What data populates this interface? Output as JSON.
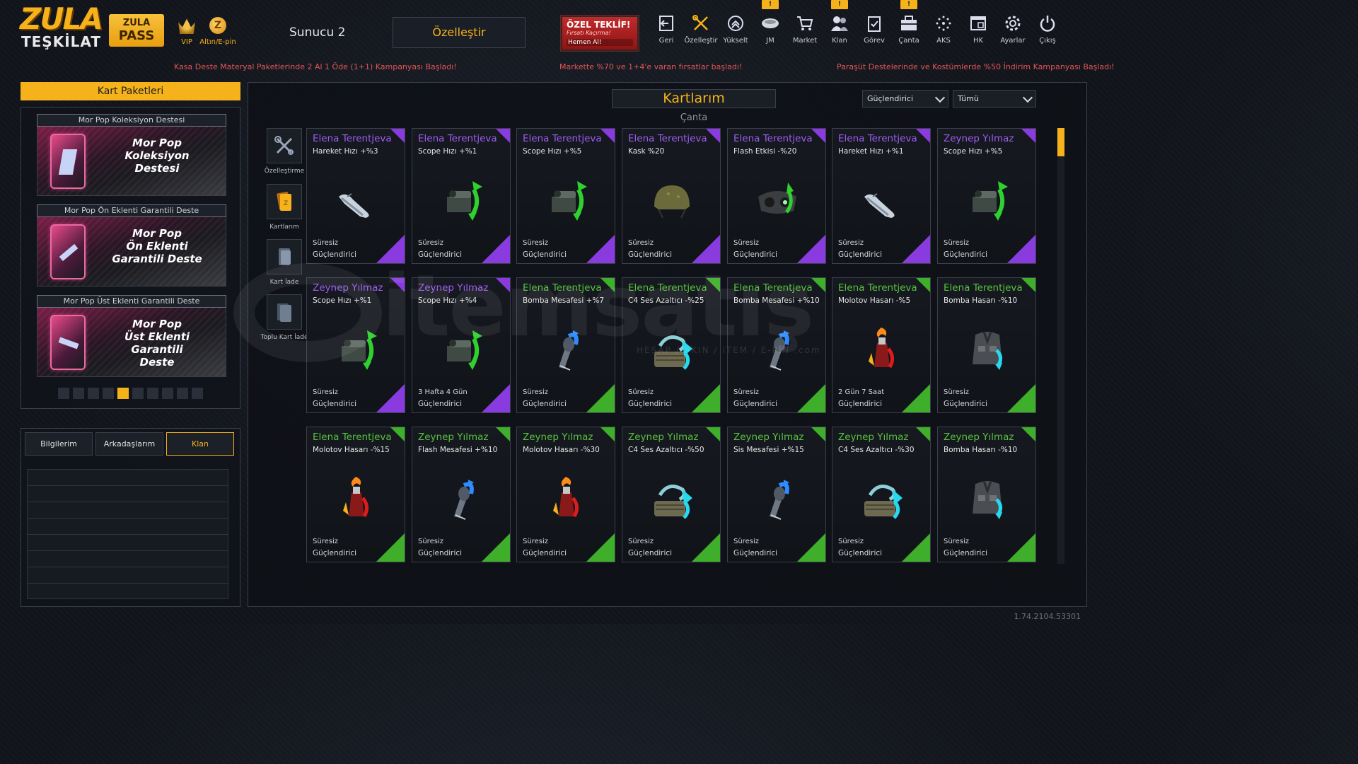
{
  "logo": {
    "line1": "ZULA",
    "line2": "TEŞKİLAT"
  },
  "zula_pass": {
    "line1": "ZULA",
    "line2": "PASS"
  },
  "vip": {
    "label": "VIP"
  },
  "gold": {
    "label": "Altın/E-pin",
    "glyph": "Z"
  },
  "server": "Sunucu 2",
  "customize": "Özelleştir",
  "offer": {
    "title": "ÖZEL TEKLİF!",
    "sub": "Fırsatı Kaçırma!",
    "cta": "Hemen Al!"
  },
  "nav": [
    {
      "label": "Geri",
      "icon": "back-icon"
    },
    {
      "label": "Özelleştir",
      "icon": "tools-icon"
    },
    {
      "label": "Yükselt",
      "icon": "upgrade-icon"
    },
    {
      "label": "JM",
      "icon": "jm-icon",
      "badge": "!"
    },
    {
      "label": "Market",
      "icon": "cart-icon"
    },
    {
      "label": "Klan",
      "icon": "clan-icon",
      "badge": "!"
    },
    {
      "label": "Görev",
      "icon": "mission-icon"
    },
    {
      "label": "Çanta",
      "icon": "bag-icon",
      "badge": "!"
    },
    {
      "label": "AKS",
      "icon": "aks-icon"
    },
    {
      "label": "HK",
      "icon": "hk-icon"
    },
    {
      "label": "Ayarlar",
      "icon": "gear-icon"
    },
    {
      "label": "Çıkış",
      "icon": "power-icon"
    }
  ],
  "announcements": [
    "Kasa Deste Materyal Paketlerinde 2 Al 1 Öde (1+1) Kampanyası Başladı!",
    "Markette %70 ve 1+4'e varan fırsatlar başladı!",
    "Paraşüt Destelerinde ve Kostümlerde %50 İndirim Kampanyası Başladı!"
  ],
  "kart_paketleri": {
    "title": "Kart Paketleri",
    "packs": [
      {
        "title": "Mor Pop Koleksiyon Destesi",
        "name": "Mor Pop\nKoleksiyon\nDestesi"
      },
      {
        "title": "Mor Pop Ön Eklenti Garantili Deste",
        "name": "Mor Pop\nÖn Eklenti\nGarantili Deste"
      },
      {
        "title": "Mor Pop Üst Eklenti Garantili Deste",
        "name": "Mor Pop\nÜst Eklenti Garantili\nDeste"
      }
    ],
    "page_count": 10,
    "active_page": 5
  },
  "social_tabs": [
    "Bilgilerim",
    "Arkadaşlarım",
    "Klan"
  ],
  "social_active": "Klan",
  "main": {
    "title": "Kartlarım",
    "subtitle": "Çanta",
    "filter_type": "Güçlendirici",
    "filter_all": "Tümü"
  },
  "side_tools": [
    {
      "label": "Özelleştirme",
      "icon": "tools-icon"
    },
    {
      "label": "Kartlarım",
      "icon": "cards-icon"
    },
    {
      "label": "Kart İade",
      "icon": "card-return-icon"
    },
    {
      "label": "Toplu Kart İade",
      "icon": "bulk-card-return-icon"
    }
  ],
  "colors": {
    "accent": "#f5b21a",
    "purple": "#8a3be0",
    "purple_text": "#9b5df0",
    "green": "#3fae2a",
    "green_text": "#58c23f",
    "red_text": "#e25656"
  },
  "cards": [
    {
      "owner": "Elena Terentjeva",
      "stat": "Hareket Hızı +%3",
      "duration": "Süresiz",
      "category": "Güçlendirici",
      "rarity": "purple",
      "art": "shoe"
    },
    {
      "owner": "Elena Terentjeva",
      "stat": "Scope Hızı +%1",
      "duration": "Süresiz",
      "category": "Güçlendirici",
      "rarity": "purple",
      "art": "scope"
    },
    {
      "owner": "Elena Terentjeva",
      "stat": "Scope Hızı +%5",
      "duration": "Süresiz",
      "category": "Güçlendirici",
      "rarity": "purple",
      "art": "scope"
    },
    {
      "owner": "Elena Terentjeva",
      "stat": "Kask %20",
      "duration": "Süresiz",
      "category": "Güçlendirici",
      "rarity": "purple",
      "art": "helmet"
    },
    {
      "owner": "Elena Terentjeva",
      "stat": "Flash Etkisi -%20",
      "duration": "Süresiz",
      "category": "Güçlendirici",
      "rarity": "purple",
      "art": "goggles"
    },
    {
      "owner": "Elena Terentjeva",
      "stat": "Hareket Hızı +%1",
      "duration": "Süresiz",
      "category": "Güçlendirici",
      "rarity": "purple",
      "art": "shoe"
    },
    {
      "owner": "Zeynep Yılmaz",
      "stat": "Scope Hızı +%5",
      "duration": "Süresiz",
      "category": "Güçlendirici",
      "rarity": "purple",
      "art": "scope"
    },
    {
      "owner": "Zeynep Yılmaz",
      "stat": "Scope Hızı +%1",
      "duration": "Süresiz",
      "category": "Güçlendirici",
      "rarity": "purple",
      "art": "scope"
    },
    {
      "owner": "Zeynep Yılmaz",
      "stat": "Scope Hızı +%4",
      "duration": "3 Hafta 4 Gün",
      "category": "Güçlendirici",
      "rarity": "purple",
      "art": "scope"
    },
    {
      "owner": "Elena Terentjeva",
      "stat": "Bomba Mesafesi +%7",
      "duration": "Süresiz",
      "category": "Güçlendirici",
      "rarity": "green",
      "art": "grenade"
    },
    {
      "owner": "Elena Terentjeva",
      "stat": "C4 Ses Azaltıcı -%25",
      "duration": "Süresiz",
      "category": "Güçlendirici",
      "rarity": "green",
      "art": "c4"
    },
    {
      "owner": "Elena Terentjeva",
      "stat": "Bomba Mesafesi +%10",
      "duration": "Süresiz",
      "category": "Güçlendirici",
      "rarity": "green",
      "art": "grenade"
    },
    {
      "owner": "Elena Terentjeva",
      "stat": "Molotov Hasarı -%5",
      "duration": "2 Gün 7 Saat",
      "category": "Güçlendirici",
      "rarity": "green",
      "art": "molotov"
    },
    {
      "owner": "Elena Terentjeva",
      "stat": "Bomba Hasarı -%10",
      "duration": "Süresiz",
      "category": "Güçlendirici",
      "rarity": "green",
      "art": "vest"
    },
    {
      "owner": "Elena Terentjeva",
      "stat": "Molotov Hasarı -%15",
      "duration": "Süresiz",
      "category": "Güçlendirici",
      "rarity": "green",
      "art": "molotov"
    },
    {
      "owner": "Zeynep Yılmaz",
      "stat": "Flash Mesafesi +%10",
      "duration": "Süresiz",
      "category": "Güçlendirici",
      "rarity": "green",
      "art": "grenade"
    },
    {
      "owner": "Zeynep Yılmaz",
      "stat": "Molotov Hasarı -%30",
      "duration": "Süresiz",
      "category": "Güçlendirici",
      "rarity": "green",
      "art": "molotov"
    },
    {
      "owner": "Zeynep Yılmaz",
      "stat": "C4 Ses Azaltıcı -%50",
      "duration": "Süresiz",
      "category": "Güçlendirici",
      "rarity": "green",
      "art": "c4"
    },
    {
      "owner": "Zeynep Yılmaz",
      "stat": "Sis Mesafesi +%15",
      "duration": "Süresiz",
      "category": "Güçlendirici",
      "rarity": "green",
      "art": "grenade"
    },
    {
      "owner": "Zeynep Yılmaz",
      "stat": "C4 Ses Azaltıcı -%30",
      "duration": "Süresiz",
      "category": "Güçlendirici",
      "rarity": "green",
      "art": "c4"
    },
    {
      "owner": "Zeynep Yılmaz",
      "stat": "Bomba Hasarı -%10",
      "duration": "Süresiz",
      "category": "Güçlendirici",
      "rarity": "green",
      "art": "vest"
    }
  ],
  "watermark": {
    "text": "itemsatış",
    "sub": "HESAP / SKIN / ITEM / E-PIN .com"
  },
  "version": "1.74.2104.53301"
}
